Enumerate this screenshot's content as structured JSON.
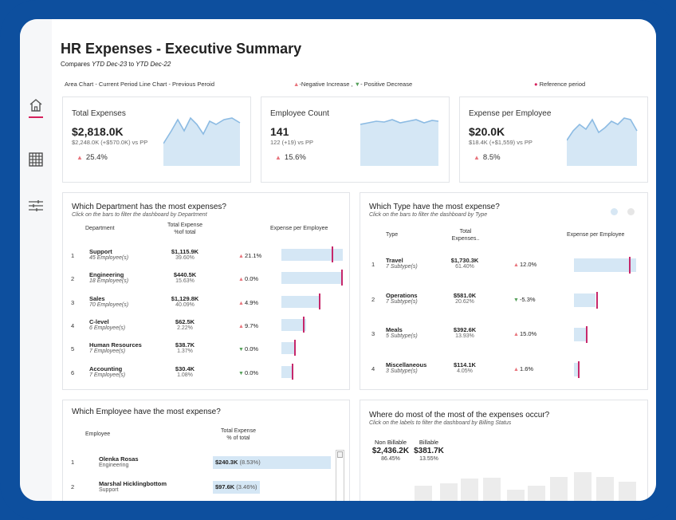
{
  "header": {
    "title": "HR Expenses - Executive Summary",
    "compare_prefix": "Compares ",
    "compare_current": "YTD Dec-23",
    "compare_to": " to ",
    "compare_previous": "YTD Dec-22"
  },
  "legend": {
    "chart_types": "Area Chart - Current Period   Line Chart - Previous Peroid",
    "negative_increase": "-Negative Increase ,",
    "positive_decrease": "- Positive Decrease",
    "reference": "Reference period"
  },
  "sidebar": {
    "items": [
      {
        "icon": "home-icon"
      },
      {
        "icon": "grid-icon"
      },
      {
        "icon": "filter-sliders-icon"
      }
    ]
  },
  "kpis": [
    {
      "label": "Total Expenses",
      "value": "$2,818.0K",
      "sub": "$2,248.0K (+$570.0K) vs PP",
      "change": "25.4%"
    },
    {
      "label": "Employee Count",
      "value": "141",
      "sub": "122 (+19) vs PP",
      "change": "15.6%"
    },
    {
      "label": "Expense per Employee",
      "value": "$20.0K",
      "sub": "$18.4K (+$1,559) vs PP",
      "change": "8.5%"
    }
  ],
  "departments": {
    "title": "Which Department has the most expenses?",
    "hint": "Click on the bars to filter the dashboard by Department",
    "col_dept": "Department",
    "col_total": "Total Expense\n%of total",
    "col_epe": "Expense per Employee",
    "rows": [
      {
        "rank": "1",
        "name": "Support",
        "sub": "45 Employee(s)",
        "total": "$1,115.9K",
        "pct": "39.60%",
        "dir": "up",
        "change": "21.1%",
        "bar": 1.0,
        "ref": 0.83
      },
      {
        "rank": "2",
        "name": "Engineering",
        "sub": "18 Employee(s)",
        "total": "$440.5K",
        "pct": "15.63%",
        "dir": "up",
        "change": "0.0%",
        "bar": 1.0,
        "ref": 0.99
      },
      {
        "rank": "3",
        "name": "Sales",
        "sub": "70 Employee(s)",
        "total": "$1,129.8K",
        "pct": "40.09%",
        "dir": "up",
        "change": "4.9%",
        "bar": 0.62,
        "ref": 0.62
      },
      {
        "rank": "4",
        "name": "C-level",
        "sub": "6 Employee(s)",
        "total": "$62.5K",
        "pct": "2.22%",
        "dir": "up",
        "change": "9.7%",
        "bar": 0.4,
        "ref": 0.37
      },
      {
        "rank": "5",
        "name": "Human Resources",
        "sub": "7 Employee(s)",
        "total": "$38.7K",
        "pct": "1.37%",
        "dir": "down",
        "change": "0.0%",
        "bar": 0.24,
        "ref": 0.22
      },
      {
        "rank": "6",
        "name": "Accounting",
        "sub": "7 Employee(s)",
        "total": "$30.4K",
        "pct": "1.08%",
        "dir": "down",
        "change": "0.0%",
        "bar": 0.2,
        "ref": 0.18
      }
    ]
  },
  "types": {
    "title": "Which Type have the most expense?",
    "hint": "Click on the bars to filter the dashboard by Type",
    "col_type": "Type",
    "col_total": "Total\nExpenses..",
    "col_epe": "Expense per Employee",
    "rows": [
      {
        "rank": "1",
        "name": "Travel",
        "sub": "7 Subtype(s)",
        "total": "$1,730.3K",
        "pct": "61.40%",
        "dir": "up",
        "change": "12.0%",
        "bar": 1.0,
        "ref": 0.9
      },
      {
        "rank": "2",
        "name": "Operations",
        "sub": "7 Subtype(s)",
        "total": "$581.0K",
        "pct": "20.62%",
        "dir": "down",
        "change": "-5.3%",
        "bar": 0.35,
        "ref": 0.37
      },
      {
        "rank": "3",
        "name": "Meals",
        "sub": "5 Subtype(s)",
        "total": "$392.6K",
        "pct": "13.93%",
        "dir": "up",
        "change": "15.0%",
        "bar": 0.22,
        "ref": 0.2
      },
      {
        "rank": "4",
        "name": "Miscellaneous",
        "sub": "3 Subtype(s)",
        "total": "$114.1K",
        "pct": "4.05%",
        "dir": "up",
        "change": "1.6%",
        "bar": 0.07,
        "ref": 0.08
      }
    ]
  },
  "employees": {
    "title": "Which Employee have the most expense?",
    "col_emp": "Employee",
    "col_total": "Total Expense\n% of total",
    "rows": [
      {
        "rank": "1",
        "name": "Olenka Rosas",
        "dept": "Engineering",
        "value": "$240.3K",
        "pct": "(8.53%)",
        "bar": 1.0
      },
      {
        "rank": "2",
        "name": "Marshal Hicklingbottom",
        "dept": "Support",
        "value": "$97.6K",
        "pct": "(3.46%)",
        "bar": 0.4
      }
    ]
  },
  "billing": {
    "title": "Where do most of the most of the expenses occur?",
    "hint": "Click on the labels to filter the dashboard by Billing Status",
    "non_billable_label": "Non Billable",
    "non_billable_value": "$2,436.2K",
    "non_billable_pct": "86.45%",
    "billable_label": "Billable",
    "billable_value": "$381.7K",
    "billable_pct": "13.55%"
  },
  "colors": {
    "brand_border": "#0d4f9e",
    "area_fill": "#d5e7f5",
    "line": "#8cbbe3",
    "reference": "#c6286b",
    "increase": "#e8747c",
    "decrease": "#55a05a"
  }
}
